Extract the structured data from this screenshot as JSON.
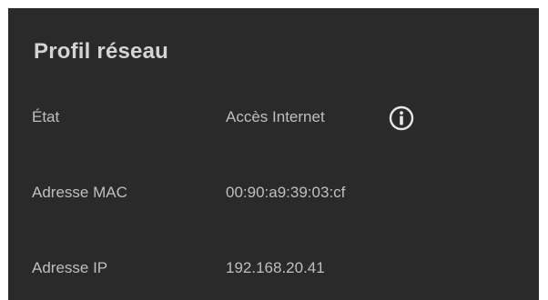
{
  "panel": {
    "title": "Profil réseau",
    "rows": [
      {
        "label": "État",
        "value": "Accès Internet",
        "icon": "info-icon"
      },
      {
        "label": "Adresse MAC",
        "value": "00:90:a9:39:03:cf"
      },
      {
        "label": "Adresse IP",
        "value": "192.168.20.41"
      }
    ]
  },
  "colors": {
    "panel_background": "#2a2a2a",
    "text": "#bfbfbf",
    "title_text": "#d4d4d4",
    "icon": "#e6e6e6"
  }
}
